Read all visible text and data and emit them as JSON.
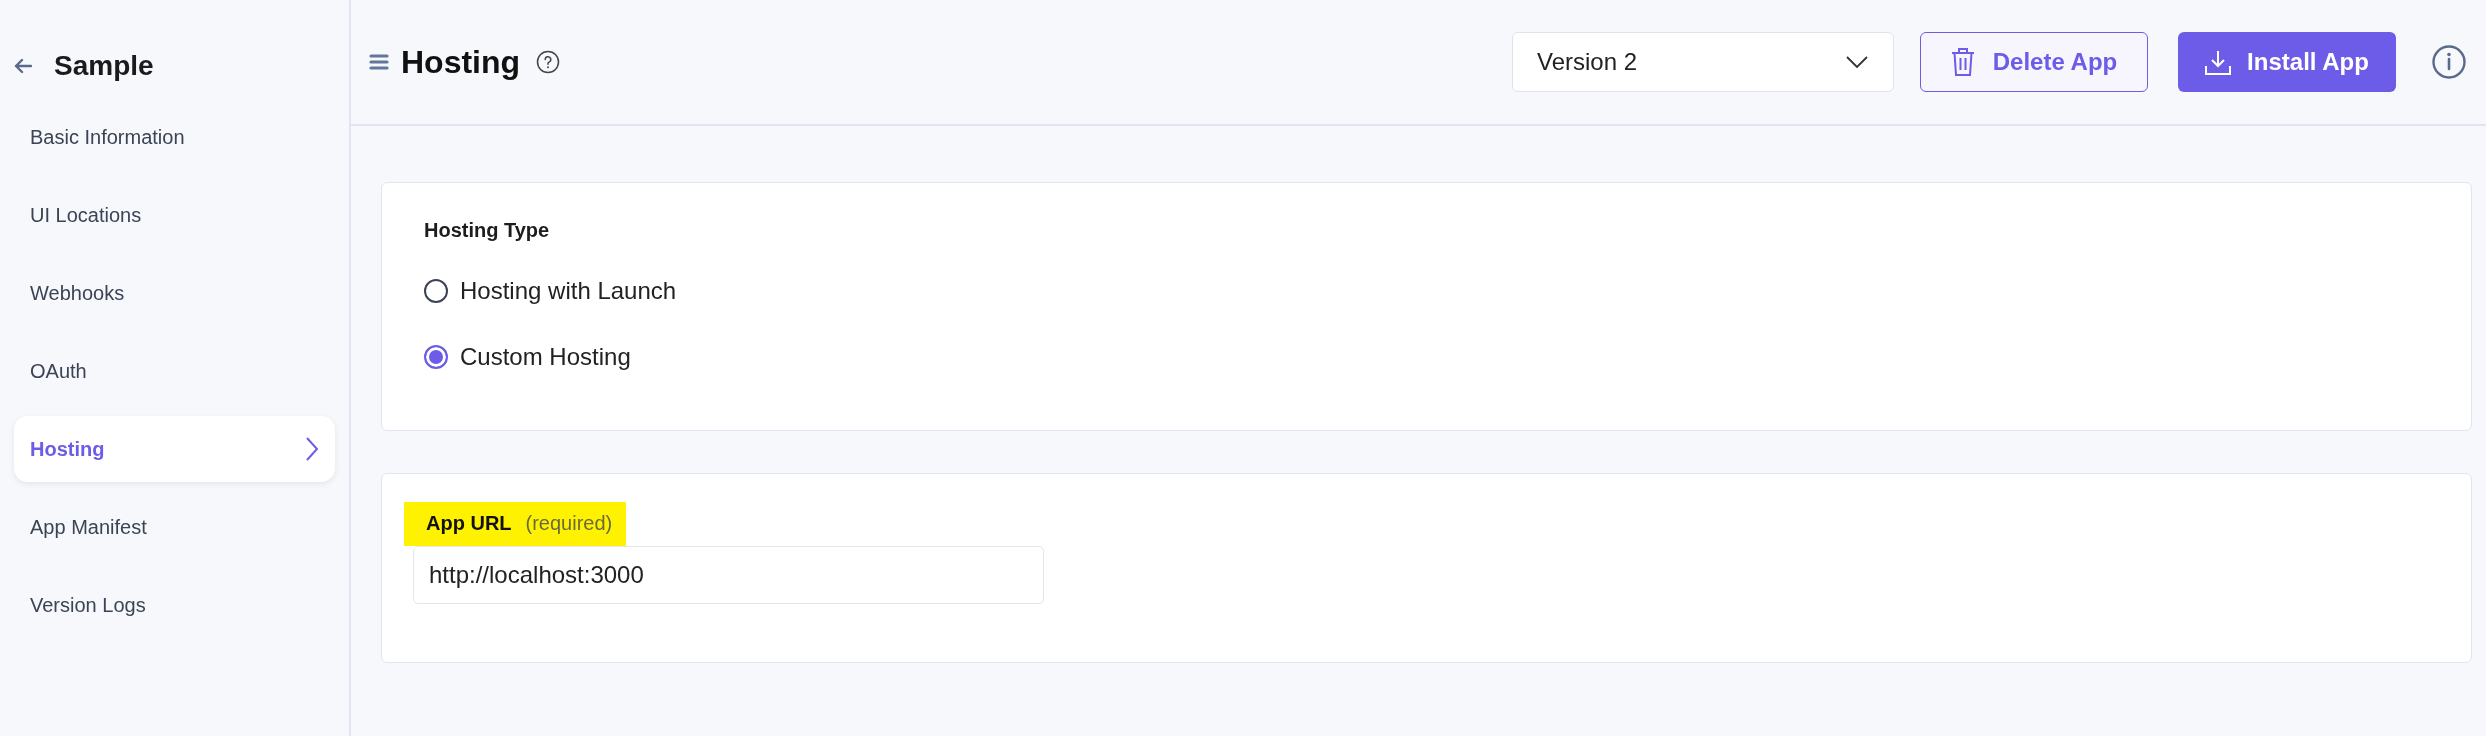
{
  "sidebar": {
    "title": "Sample",
    "items": [
      {
        "label": "Basic Information",
        "selected": false
      },
      {
        "label": "UI Locations",
        "selected": false
      },
      {
        "label": "Webhooks",
        "selected": false
      },
      {
        "label": "OAuth",
        "selected": false
      },
      {
        "label": "Hosting",
        "selected": true
      },
      {
        "label": "App Manifest",
        "selected": false
      },
      {
        "label": "Version Logs",
        "selected": false
      }
    ]
  },
  "header": {
    "title": "Hosting",
    "version_select": {
      "value": "Version 2"
    },
    "delete_button": "Delete App",
    "install_button": "Install App"
  },
  "hosting_type": {
    "title": "Hosting Type",
    "options": [
      {
        "label": "Hosting with Launch",
        "selected": false
      },
      {
        "label": "Custom Hosting",
        "selected": true
      }
    ]
  },
  "app_url": {
    "label": "App URL",
    "hint": "(required)",
    "value": "http://localhost:3000"
  }
}
